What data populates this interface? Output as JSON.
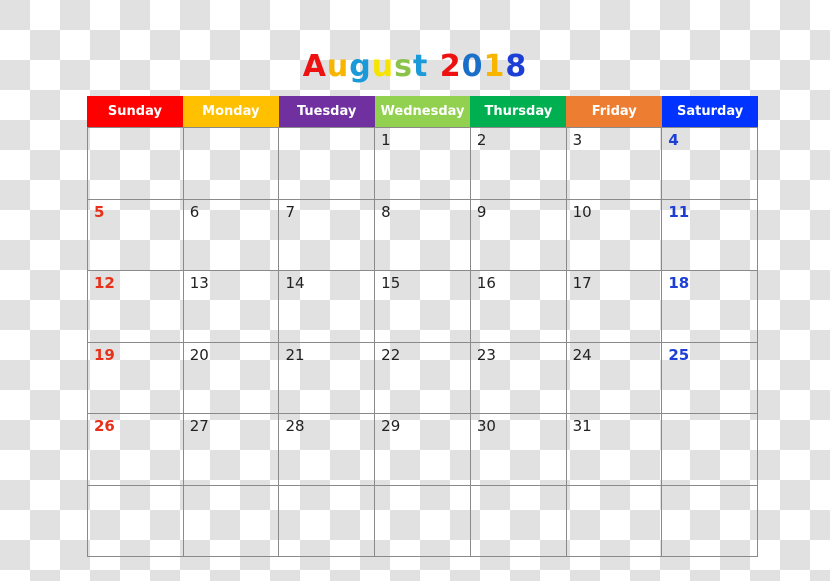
{
  "title": {
    "month": "August",
    "year": "2018",
    "letters": [
      {
        "ch": "A",
        "color": "#ee1111"
      },
      {
        "ch": "u",
        "color": "#f7b500"
      },
      {
        "ch": "g",
        "color": "#1a9ad8"
      },
      {
        "ch": "u",
        "color": "#f5e400"
      },
      {
        "ch": "s",
        "color": "#8bc34a"
      },
      {
        "ch": "t",
        "color": "#1a9ad8"
      },
      {
        "ch": " ",
        "color": "#000000"
      },
      {
        "ch": "2",
        "color": "#ee1111"
      },
      {
        "ch": "0",
        "color": "#1a6fc8"
      },
      {
        "ch": "1",
        "color": "#f7b500"
      },
      {
        "ch": "8",
        "color": "#1d3fd6"
      }
    ]
  },
  "days": [
    {
      "label": "Sunday",
      "color": "#ff0000"
    },
    {
      "label": "Monday",
      "color": "#ffc000"
    },
    {
      "label": "Tuesday",
      "color": "#7030a0"
    },
    {
      "label": "Wednesday",
      "color": "#92d050"
    },
    {
      "label": "Thursday",
      "color": "#00b050"
    },
    {
      "label": "Friday",
      "color": "#ed7d31"
    },
    {
      "label": "Saturday",
      "color": "#0033ff"
    }
  ],
  "weeks": [
    [
      "",
      "",
      "",
      "1",
      "2",
      "3",
      "4"
    ],
    [
      "5",
      "6",
      "7",
      "8",
      "9",
      "10",
      "11"
    ],
    [
      "12",
      "13",
      "14",
      "15",
      "16",
      "17",
      "18"
    ],
    [
      "19",
      "20",
      "21",
      "22",
      "23",
      "24",
      "25"
    ],
    [
      "26",
      "27",
      "28",
      "29",
      "30",
      "31",
      ""
    ],
    [
      "",
      "",
      "",
      "",
      "",
      "",
      ""
    ]
  ]
}
